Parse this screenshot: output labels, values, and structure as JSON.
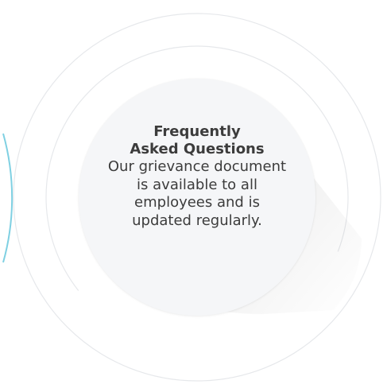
{
  "infographic": {
    "title": "Frequently Asked Questions",
    "body": "Our grievance document is available to all employees and is updated regularly."
  },
  "colors": {
    "background": "#ffffff",
    "disc_fill": "#f5f6f8",
    "ring_stroke": "#e6e8eb",
    "accent_arc": "#7fd0e2",
    "text": "#3c3c3c"
  }
}
